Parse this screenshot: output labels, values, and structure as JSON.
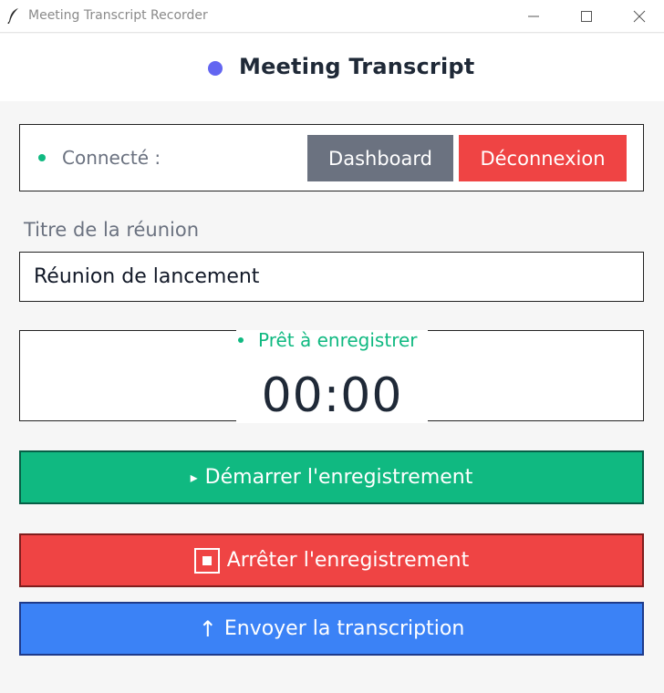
{
  "window": {
    "title": "Meeting Transcript Recorder",
    "app_icon": "feather-icon",
    "controls": [
      "minimize-icon",
      "maximize-icon",
      "close-icon"
    ]
  },
  "header": {
    "title": "Meeting Transcript",
    "dot_color": "#6366f1"
  },
  "connection": {
    "label": "Connecté :",
    "dot_color": "#10b981",
    "dashboard_label": "Dashboard",
    "logout_label": "Déconnexion"
  },
  "meeting": {
    "title_label": "Titre de la réunion",
    "title_value": "Réunion de lancement"
  },
  "status": {
    "label": "Prêt à enregistrer",
    "timer": "00:00",
    "color": "#10b981"
  },
  "actions": {
    "start_icon": "▸",
    "start_label": "Démarrer l'enregistrement",
    "stop_label": "Arrêter l'enregistrement",
    "send_icon": "↑",
    "send_label": "Envoyer la transcription"
  },
  "colors": {
    "start": "#10b981",
    "stop": "#ef4444",
    "send": "#3b82f6",
    "dashboard": "#6b7280"
  }
}
